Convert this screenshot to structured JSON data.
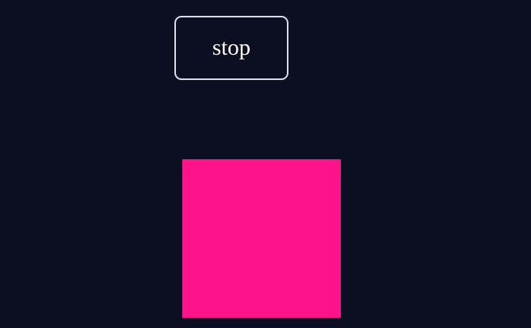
{
  "controls": {
    "stop_label": "stop"
  },
  "colors": {
    "background": "#0b0f21",
    "button_border": "#d9dce3",
    "button_text": "#ffffff",
    "box": "#ff138a"
  }
}
